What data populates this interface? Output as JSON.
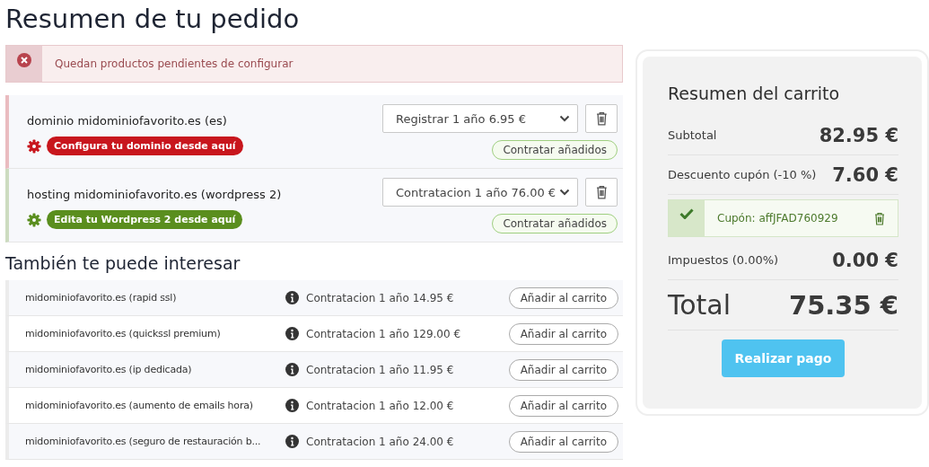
{
  "title": "Resumen de tu pedido",
  "alert": {
    "message": "Quedan productos pendientes de configurar"
  },
  "products": [
    {
      "name": "dominio midominiofavorito.es (es)",
      "option": "Registrar 1 año 6.95 €",
      "badge": "Configura tu dominio desde aquí",
      "color": "#c8161d",
      "addons": "Contratar añadidos"
    },
    {
      "name": "hosting midominiofavorito.es (wordpress 2)",
      "option": "Contratacion 1 año 76.00 €",
      "badge": "Edita tu Wordpress 2 desde aquí",
      "color": "#5a8e1e",
      "addons": "Contratar añadidos"
    }
  ],
  "suggestions_title": "También te puede interesar",
  "suggestions": [
    {
      "name": "midominiofavorito.es (rapid ssl)",
      "price": "Contratacion 1 año 14.95 €",
      "button": "Añadir al carrito"
    },
    {
      "name": "midominiofavorito.es (quickssl premium)",
      "price": "Contratacion 1 año 129.00 €",
      "button": "Añadir al carrito"
    },
    {
      "name": "midominiofavorito.es (ip dedicada)",
      "price": "Contratacion 1 año 11.95 €",
      "button": "Añadir al carrito"
    },
    {
      "name": "midominiofavorito.es (aumento de emails hora)",
      "price": "Contratacion 1 año 12.00 €",
      "button": "Añadir al carrito"
    },
    {
      "name": "midominiofavorito.es (seguro de restauración b...",
      "price": "Contratacion 1 año 24.00 €",
      "button": "Añadir al carrito"
    }
  ],
  "cart": {
    "title": "Resumen del carrito",
    "rows": [
      {
        "kind": "line",
        "label": "Subtotal",
        "value": "82.95 €"
      },
      {
        "kind": "line",
        "label": "Descuento cupón (-10 %)",
        "value": "7.60 €"
      },
      {
        "kind": "coupon",
        "label": "Cupón: affJFAD760929"
      },
      {
        "kind": "line",
        "label": "Impuestos (0.00%)",
        "value": "0.00 €"
      },
      {
        "kind": "total",
        "label": "Total",
        "value": "75.35 €"
      }
    ],
    "button": "Realizar pago"
  }
}
